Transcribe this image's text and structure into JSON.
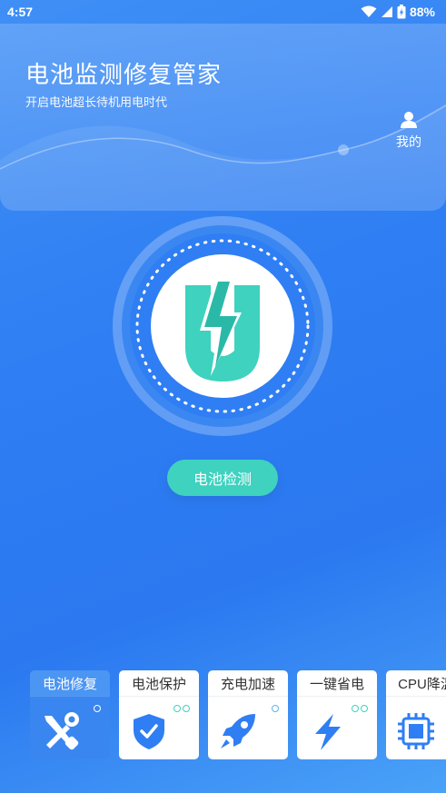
{
  "status_bar": {
    "time": "4:57",
    "battery": "88%"
  },
  "header": {
    "title": "电池监测修复管家",
    "subtitle": "开启电池超长待机用电时代",
    "mine_label": "我的"
  },
  "main": {
    "check_button": "电池检测"
  },
  "colors": {
    "accent_teal": "#3ed2bf",
    "primary_blue": "#2f7ef3"
  },
  "features": [
    {
      "label": "电池修复",
      "icon": "repair-tools-icon",
      "active": true
    },
    {
      "label": "电池保护",
      "icon": "shield-check-icon",
      "active": false
    },
    {
      "label": "充电加速",
      "icon": "rocket-icon",
      "active": false
    },
    {
      "label": "一键省电",
      "icon": "lightning-icon",
      "active": false
    },
    {
      "label": "CPU降温",
      "icon": "cpu-chip-icon",
      "active": false
    }
  ]
}
